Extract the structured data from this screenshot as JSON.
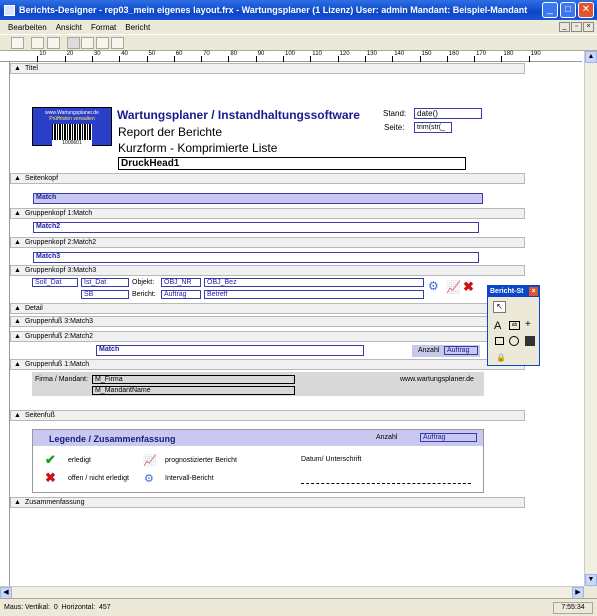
{
  "window": {
    "title": "Berichts-Designer - rep03_mein eigenes layout.frx - Wartungsplaner  (1 Lizenz)   User: admin   Mandant: Beispiel-Mandant"
  },
  "menu": [
    "Bearbeiten",
    "Ansicht",
    "Format",
    "Bericht"
  ],
  "ruler": [
    "10",
    "20",
    "30",
    "40",
    "50",
    "60",
    "70",
    "80",
    "90",
    "100",
    "110",
    "120",
    "130",
    "140",
    "150",
    "160",
    "170",
    "180",
    "190"
  ],
  "bands": {
    "titel": "Titel",
    "seitenkopf": "Seitenkopf",
    "gk1": "Gruppenkopf 1:Match",
    "gk2": "Gruppenkopf 2:Match2",
    "gk3": "Gruppenkopf 3:Match3",
    "detail": "Detail",
    "gf3": "Gruppenfuß 3:Match3",
    "gf2": "Gruppenfuß 2:Match2",
    "gf1": "Gruppenfuß 1:Match",
    "seitenfuss": "Seitenfuß",
    "zusammen": "Zusammenfassung"
  },
  "header": {
    "logo_line1": "www.Wartungsplaner.de",
    "logo_line2": "Prüffristen verwalten",
    "barcode": "1000601",
    "title": "Wartungsplaner / Instandhaltungssoftware",
    "report": "Report der Berichte",
    "subtitle": "Kurzform - Komprimierte Liste",
    "druckhead": "DruckHead1",
    "stand_label": "Stand:",
    "stand_value": "date()",
    "seite_label": "Seite:",
    "seite_value": "trim(str(_"
  },
  "match": {
    "m1": "Match",
    "m2": "Match2",
    "m3": "Match3"
  },
  "detail": {
    "soll_dat": "Soll_Dat",
    "ist_dat": "Ist_Dat",
    "objekt_label": "Objekt:",
    "obj_nr": "OBJ_NR",
    "obj_bez": "OBJ_Bez",
    "sb": "SB",
    "bericht_label": "Bericht:",
    "auftrag": "Auftrag",
    "betreff": "Betreff"
  },
  "gf2": {
    "match": "Match",
    "anzahl_label": "Anzahl",
    "anzahl_value": "Auftrag"
  },
  "gf1": {
    "firma_label": "Firma / Mandant:",
    "firma": "M_Firma",
    "mandant": "M_MandantName",
    "url": "www.wartungsplaner.de"
  },
  "legend": {
    "title": "Legende / Zusammenfassung",
    "anzahl_label": "Anzahl",
    "anzahl_value": "Auftrag",
    "erledigt": "erledigt",
    "offen": "offen / nicht erledigt",
    "prognose": "prognostizierter Bericht",
    "intervall": "Intervall-Bericht",
    "datum": "Datum/ Unterschrift"
  },
  "popup": {
    "title": "Bericht-St"
  },
  "status": {
    "maus_label": "Maus:",
    "vertikal_label": "Vertikal:",
    "vertikal": "0",
    "horizontal_label": "Horizontal:",
    "horizontal": "457",
    "time": "7:55:34"
  }
}
